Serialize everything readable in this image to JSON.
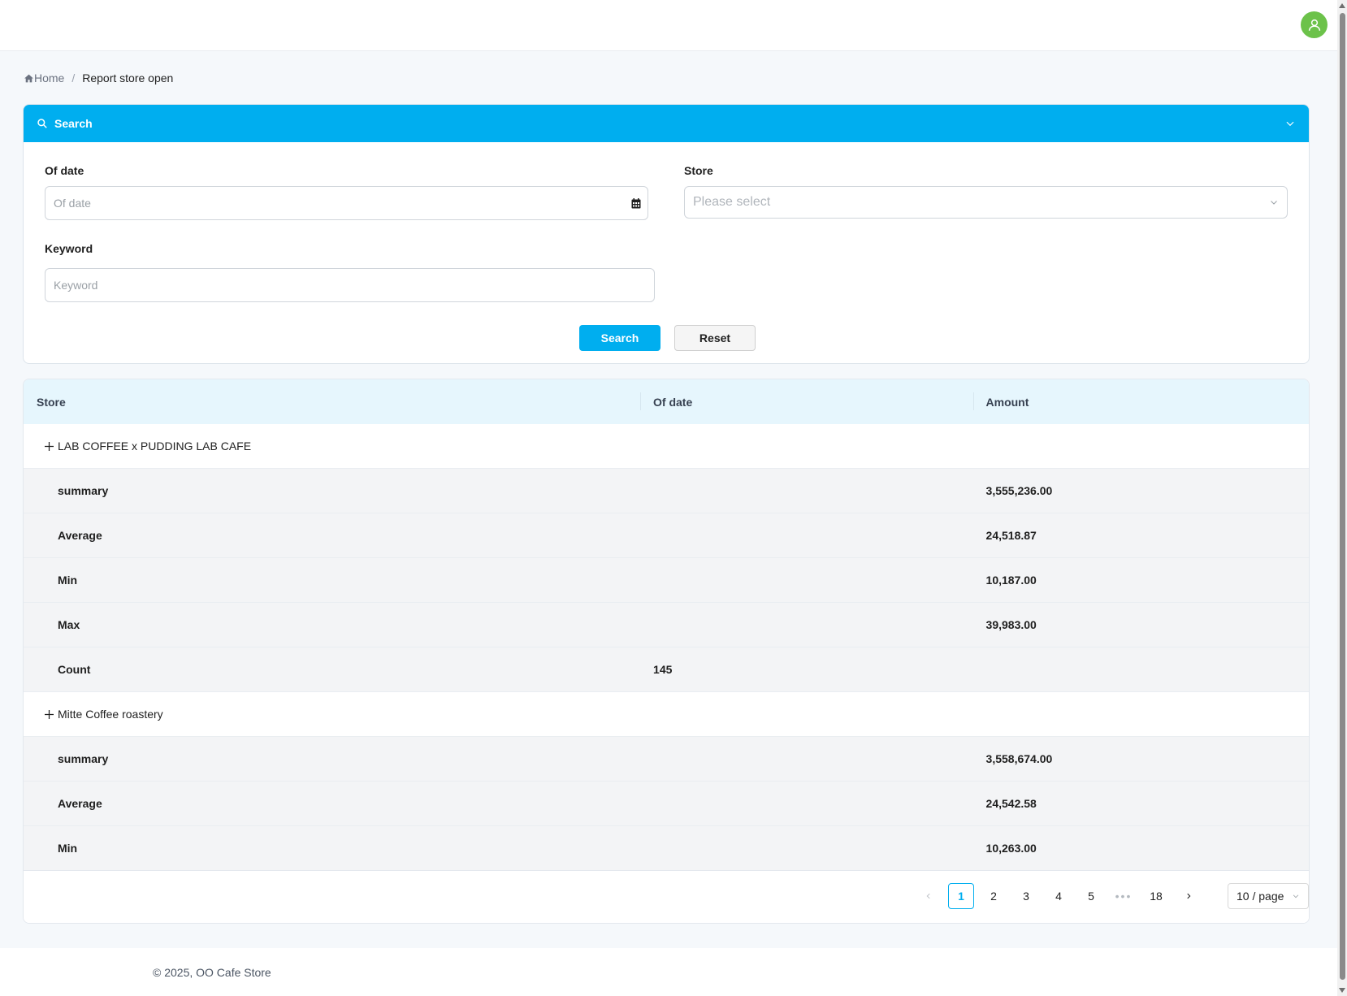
{
  "header": {
    "avatar_icon": "user-icon",
    "avatar_color": "#6cc24a"
  },
  "breadcrumb": {
    "home": "Home",
    "current": "Report store open",
    "home_icon": "home-icon"
  },
  "search_panel": {
    "title": "Search",
    "accent_color": "#00aeef",
    "of_date_label": "Of date",
    "of_date_placeholder": "Of date",
    "store_label": "Store",
    "store_placeholder": "Please select",
    "keyword_label": "Keyword",
    "keyword_placeholder": "Keyword",
    "search_button": "Search",
    "reset_button": "Reset"
  },
  "table": {
    "columns": [
      "Store",
      "Of date",
      "Amount"
    ],
    "groups": [
      {
        "store": "LAB COFFEE x PUDDING LAB CAFE",
        "rows": [
          {
            "label": "summary",
            "of_date": "",
            "amount": "3,555,236.00"
          },
          {
            "label": "Average",
            "of_date": "",
            "amount": "24,518.87"
          },
          {
            "label": "Min",
            "of_date": "",
            "amount": "10,187.00"
          },
          {
            "label": "Max",
            "of_date": "",
            "amount": "39,983.00"
          },
          {
            "label": "Count",
            "of_date": "145",
            "amount": ""
          }
        ]
      },
      {
        "store": "Mitte Coffee roastery",
        "rows": [
          {
            "label": "summary",
            "of_date": "",
            "amount": "3,558,674.00"
          },
          {
            "label": "Average",
            "of_date": "",
            "amount": "24,542.58"
          },
          {
            "label": "Min",
            "of_date": "",
            "amount": "10,263.00"
          }
        ]
      }
    ]
  },
  "pagination": {
    "pages": [
      "1",
      "2",
      "3",
      "4",
      "5",
      "•••",
      "18"
    ],
    "current": "1",
    "page_size": "10 / page"
  },
  "footer": {
    "copyright": "© 2025, OO Cafe Store"
  }
}
